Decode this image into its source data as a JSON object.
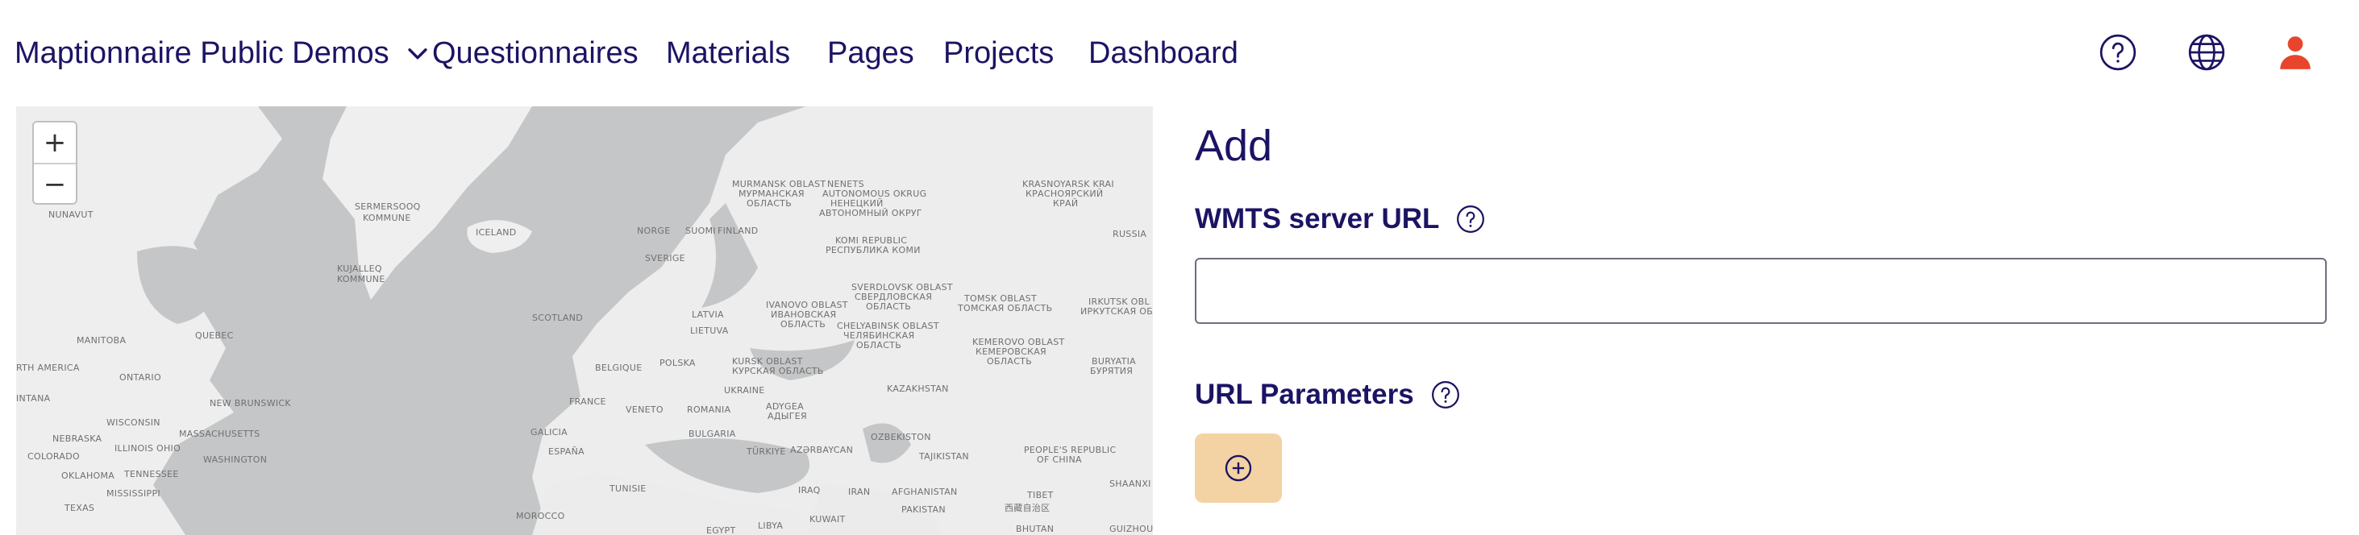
{
  "header": {
    "org_name": "Maptionnaire Public Demos",
    "nav": [
      "Questionnaires",
      "Materials",
      "Pages",
      "Projects",
      "Dashboard"
    ],
    "icons": [
      "help-circle-icon",
      "globe-icon",
      "user-icon"
    ],
    "user_icon_color": "#e8452c"
  },
  "map": {
    "zoom_in": "+",
    "zoom_out": "−",
    "labels": [
      "NUNAVUT",
      "SERMERSOOQ",
      "KOMMUNE",
      "KUJALLEQ",
      "KOMMUNE",
      "ICELAND",
      "MURMANSK OBLAST",
      "МУРМАНСКАЯ",
      "ОБЛАСТЬ",
      "NENETS",
      "AUTONOMOUS OKRUG",
      "НЕНЕЦКИЙ",
      "АВТОНОМНЫЙ ОКРУГ",
      "KRASNOYARSK KRAI",
      "КРАСНОЯРСКИЙ",
      "КРАЙ",
      "NORGE",
      "SUOMI",
      "FINLAND",
      "KOMI REPUBLIC",
      "РЕСПУБЛИКА КОМИ",
      "RUSSIA",
      "SVERIGE",
      "SVERDLOVSK OBLAST",
      "СВЕРДЛОВСКАЯ",
      "ОБЛАСТЬ",
      "TOMSK OBLAST",
      "ТОМСКАЯ ОБЛАСТЬ",
      "IRKUTSK OBL",
      "ИРКУТСКАЯ ОБ",
      "MANITOBA",
      "QUEBEC",
      "SCOTLAND",
      "LATVIA",
      "LIETUVA",
      "IVANOVO OBLAST",
      "ИВАНОВСКАЯ",
      "ОБЛАСТЬ",
      "CHELYABINSK OBLAST",
      "ЧЕЛЯБИНСКАЯ",
      "ОБЛАСТЬ",
      "KEMEROVO OBLAST",
      "КЕМЕРОВСКАЯ",
      "ОБЛАСТЬ",
      "RTH AMERICA",
      "ONTARIO",
      "BELGIQUE",
      "POLSKA",
      "KURSK OBLAST",
      "КУРСКАЯ ОБЛАСТЬ",
      "BURYATIA",
      "БУРЯТИЯ",
      "INTANA",
      "NEW BRUNSWICK",
      "FRANCE",
      "UKRAINE",
      "KAZAKHSTAN",
      "WISCONSIN",
      "VENETO",
      "ROMANIA",
      "ADYGEA",
      "АДЫГЕЯ",
      "NEBRASKA",
      "MASSACHUSETTS",
      "GALICIA",
      "BULGARIA",
      "OZBEKISTON",
      "COLORADO",
      "ILLINOIS",
      "OHIO",
      "WASHINGTON",
      "ESPAÑA",
      "TÜRKIYE",
      "AZƏRBAYCAN",
      "TAJIKISTAN",
      "PEOPLE'S REPUBLIC",
      "OF CHINA",
      "OKLAHOMA",
      "TENNESSEE",
      "TUNISIE",
      "IRAQ",
      "IRAN",
      "AFGHANISTAN",
      "TIBET",
      "西藏自治区",
      "SHAANXI",
      "MISSISSIPPI",
      "TEXAS",
      "PAKISTAN",
      "MOROCCO",
      "LIBYA",
      "EGYPT",
      "KUWAIT",
      "BHUTAN",
      "GUIZHOU"
    ]
  },
  "form": {
    "title": "Add",
    "wmts_label": "WMTS server URL",
    "wmts_value": "",
    "params_label": "URL Parameters"
  }
}
